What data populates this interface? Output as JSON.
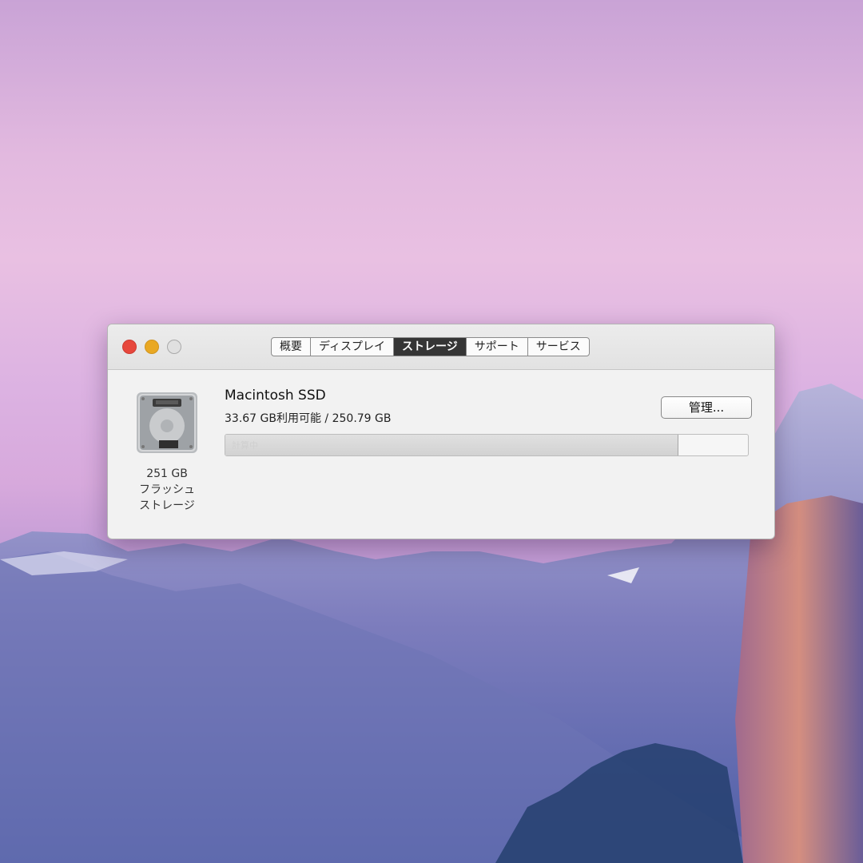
{
  "window": {
    "tabs": [
      {
        "label": "概要",
        "active": false
      },
      {
        "label": "ディスプレイ",
        "active": false
      },
      {
        "label": "ストレージ",
        "active": true
      },
      {
        "label": "サポート",
        "active": false
      },
      {
        "label": "サービス",
        "active": false
      }
    ]
  },
  "storage": {
    "drive_icon": "hard-drive-icon",
    "drive_caption": [
      "251 GB",
      "フラッシュ",
      "ストレージ"
    ],
    "volume_name": "Macintosh SSD",
    "usage_text": "33.67 GB利用可能 / 250.79 GB",
    "manage_button": "管理...",
    "bar_label": "計算中",
    "used_fraction": 0.866
  },
  "colors": {
    "close": "#e7473c",
    "minimize": "#e9a823",
    "active_tab": "#353535"
  }
}
